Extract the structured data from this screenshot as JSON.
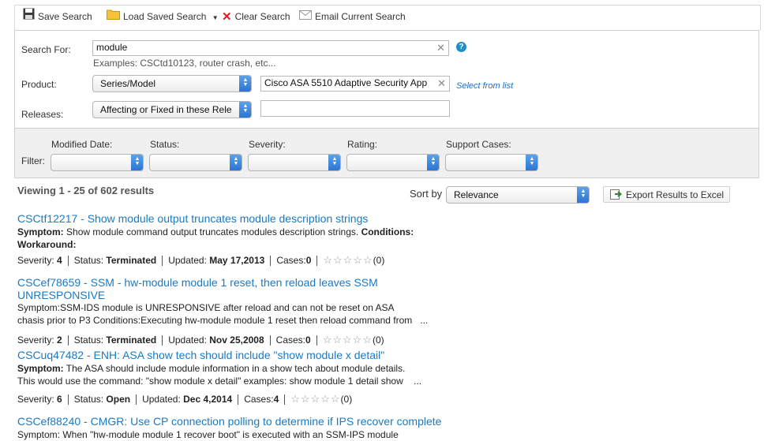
{
  "toolbar": {
    "save": "Save Search",
    "load": "Load Saved Search",
    "clear": "Clear Search",
    "email": "Email Current Search"
  },
  "search": {
    "label": "Search For:",
    "value": "module",
    "hint": "Examples: CSCtd10123, router crash, etc...",
    "help": "?"
  },
  "product": {
    "label": "Product:",
    "type": "Series/Model",
    "value": "Cisco ASA 5510 Adaptive Security App",
    "select_link": "Select from list"
  },
  "releases": {
    "label": "Releases:",
    "type": "Affecting or Fixed in these Rele",
    "value": ""
  },
  "filter": {
    "label": "Filter:",
    "modified": "Modified Date:",
    "status": "Status:",
    "severity": "Severity:",
    "rating": "Rating:",
    "support": "Support Cases:"
  },
  "results": {
    "viewing": "Viewing 1 - 25 of 602 results",
    "sort_label": "Sort by",
    "sort_value": "Relevance",
    "export": "Export Results to Excel"
  },
  "items": [
    {
      "title": "CSCtf12217 - Show module output truncates module description strings",
      "symptom_label": "Symptom:",
      "symptom": "Show module command output truncates modules description strings.",
      "conditions_label": "Conditions:",
      "workaround_label": "Workaround:",
      "severity": "4",
      "status": "Terminated",
      "updated": "May 17,2013",
      "cases": "0",
      "rating": "(0)"
    },
    {
      "title": "CSCef78659 - SSM - hw-module module 1 reset, then reload leaves SSM UNRESPONSIVE",
      "line1": "Symptom:SSM-IDS module is UNRESPONSIVE after reload and can not be reset on ASA",
      "line2": "chasis prior to P3 Conditions:Executing hw-module module 1 reset then reload command from",
      "ellipsis": "...",
      "severity": "2",
      "status": "Terminated",
      "updated": "Nov 25,2008",
      "cases": "0",
      "rating": "(0)"
    },
    {
      "title": "CSCuq47482 - ENH: ASA show tech should include \"show module x detail\"",
      "symptom_label": "Symptom:",
      "line1": "The ASA should include module information in a show tech about module details.",
      "line2": "This would use the command: \"show module x detail\" examples: show module 1 detail show",
      "ellipsis": "...",
      "severity": "6",
      "status": "Open",
      "updated": "Dec 4,2014",
      "cases": "4",
      "rating": "(0)"
    },
    {
      "title": "CSCef88240 - CMGR: Use CP connection polling to determine if IPS recover complete",
      "line1": "Symptom: When \"hw-module module 1 recover boot\" is executed with an SSM-IPS module"
    }
  ],
  "labels": {
    "severity": "Severity:",
    "status": "Status:",
    "updated": "Updated:",
    "cases": "Cases:"
  },
  "icons": [
    "floppy-icon",
    "folder-icon",
    "clear-x-icon",
    "email-icon",
    "help-icon",
    "excel-export-icon",
    "star-icon"
  ]
}
